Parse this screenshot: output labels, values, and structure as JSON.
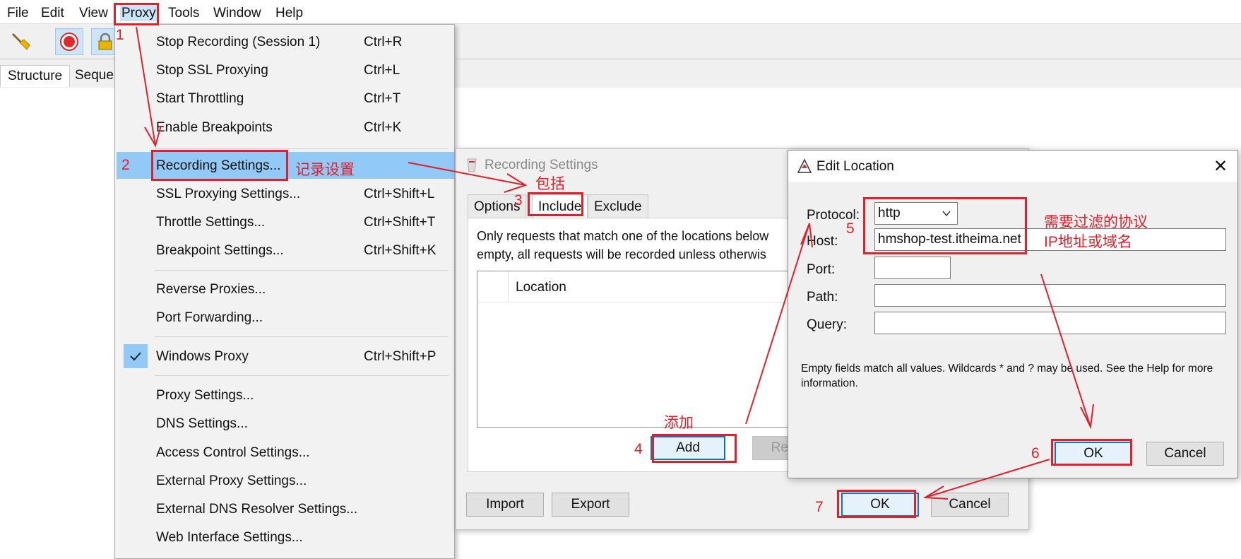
{
  "menubar": {
    "items": [
      "File",
      "Edit",
      "View",
      "Proxy",
      "Tools",
      "Window",
      "Help"
    ]
  },
  "toolbar": {
    "icons": [
      "broom-icon",
      "record-icon",
      "lock-icon"
    ]
  },
  "left_tabs": [
    "Structure",
    "Seque"
  ],
  "proxy_menu": {
    "items": [
      {
        "label": "Stop Recording (Session 1)",
        "shortcut": "Ctrl+R"
      },
      {
        "label": "Stop SSL Proxying",
        "shortcut": "Ctrl+L"
      },
      {
        "label": "Start Throttling",
        "shortcut": "Ctrl+T"
      },
      {
        "label": "Enable Breakpoints",
        "shortcut": "Ctrl+K"
      },
      {
        "label": "Recording Settings...",
        "shortcut": ""
      },
      {
        "label": "SSL Proxying Settings...",
        "shortcut": "Ctrl+Shift+L"
      },
      {
        "label": "Throttle Settings...",
        "shortcut": "Ctrl+Shift+T"
      },
      {
        "label": "Breakpoint Settings...",
        "shortcut": "Ctrl+Shift+K"
      },
      {
        "label": "Reverse Proxies...",
        "shortcut": ""
      },
      {
        "label": "Port Forwarding...",
        "shortcut": ""
      },
      {
        "label": "Windows Proxy",
        "shortcut": "Ctrl+Shift+P"
      },
      {
        "label": "Proxy Settings...",
        "shortcut": ""
      },
      {
        "label": "DNS Settings...",
        "shortcut": ""
      },
      {
        "label": "Access Control Settings...",
        "shortcut": ""
      },
      {
        "label": "External Proxy Settings...",
        "shortcut": ""
      },
      {
        "label": "External DNS Resolver Settings...",
        "shortcut": ""
      },
      {
        "label": "Web Interface Settings...",
        "shortcut": ""
      }
    ]
  },
  "recording_settings": {
    "title": "Recording Settings",
    "tabs": [
      "Options",
      "Include",
      "Exclude"
    ],
    "description_line1": "Only requests that match one of the locations below",
    "description_line2": "empty, all requests will be recorded unless otherwis",
    "table_header": "Location",
    "add_label": "Add",
    "remove_label": "Remo",
    "import_label": "Import",
    "export_label": "Export",
    "ok_label": "OK",
    "cancel_label": "Cancel"
  },
  "edit_location": {
    "title": "Edit Location",
    "close_glyph": "✕",
    "protocol_label": "Protocol:",
    "protocol_value": "http",
    "host_label": "Host:",
    "host_value": "hmshop-test.itheima.net",
    "port_label": "Port:",
    "path_label": "Path:",
    "query_label": "Query:",
    "note": "Empty fields match all values. Wildcards * and ? may be used. See the Help for more information.",
    "ok_label": "OK",
    "cancel_label": "Cancel"
  },
  "annotations": {
    "n1": "1",
    "n2": "2",
    "n3": "3",
    "n4": "4",
    "n5": "5",
    "n6": "6",
    "n7": "7",
    "recording_settings_cn": "记录设置",
    "include_cn": "包括",
    "add_cn": "添加",
    "protocol_cn": "需要过滤的协议",
    "host_cn": "IP地址或域名"
  },
  "colors": {
    "annotation_red": "#e0202a",
    "menu_highlight": "#91c9f7",
    "default_button_border": "#0078d7"
  }
}
